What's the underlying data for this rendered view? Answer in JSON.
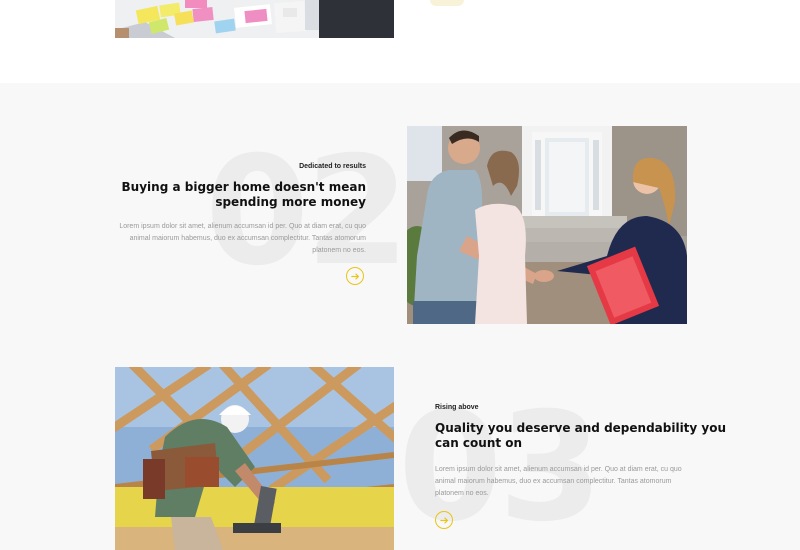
{
  "features": [
    {
      "number": "02",
      "eyebrow": "Dedicated to results",
      "heading_line1": "Buying a bigger home doesn't  mean",
      "heading_line2": "spending more money",
      "body_line1": "Lorem ipsum dolor sit amet, alienum accumsan id per. Quo at diam erat, cu quo",
      "body_line2": "animal maiorum habemus, duo ex accumsan complectitur. Tantas atomorum",
      "body_line3": "platonem no eos.",
      "photo_icon": "handshake-photo"
    },
    {
      "number": "03",
      "eyebrow": "Rising above",
      "heading_line1": "Quality you deserve and dependability you",
      "heading_line2": "can count on",
      "body_line1": "Lorem ipsum dolor sit amet, alienum accumsan id per. Quo at diam erat, cu quo",
      "body_line2": "animal maiorum habemus, duo ex accumsan complectitur. Tantas atomorum",
      "body_line3": "platonem no eos.",
      "photo_icon": "roof-construction-photo"
    }
  ],
  "colors": {
    "accent": "#e8c516",
    "section_bg": "#f8f8f8",
    "heading": "#111111",
    "body": "#9a9a9a",
    "big_number": "#ececec"
  },
  "icons": {
    "arrow": "arrow-right-icon"
  }
}
